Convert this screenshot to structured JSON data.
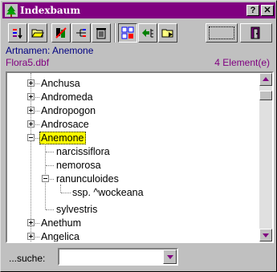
{
  "window": {
    "title": "Indexbaum",
    "help_label": "?",
    "close_label": "✕"
  },
  "toolbar": {
    "icons": [
      "sort-icon",
      "open-folder-icon",
      "tools-icon",
      "branch-icon",
      "trash-icon",
      "tree-grid-icon",
      "move-left-icon",
      "folder-open-icon",
      "select-button",
      "exit-door-icon"
    ]
  },
  "info": {
    "line1": "Artnamen: Anemone",
    "file": "Flora5.dbf",
    "count": "4 Element(e)"
  },
  "tree": {
    "nodes": [
      {
        "label": "Anchusa"
      },
      {
        "label": "Andromeda"
      },
      {
        "label": "Andropogon"
      },
      {
        "label": "Androsace"
      },
      {
        "label": "Anemone"
      },
      {
        "label": "narcissiflora"
      },
      {
        "label": "nemorosa"
      },
      {
        "label": "ranunculoides"
      },
      {
        "label": "ssp. ^wockeana"
      },
      {
        "label": "sylvestris"
      },
      {
        "label": "Anethum"
      },
      {
        "label": "Angelica"
      }
    ],
    "selected": "Anemone"
  },
  "search": {
    "label": "...suche:",
    "value": "",
    "placeholder": ""
  },
  "colors": {
    "titlebar": "#800080",
    "accent": "#800080",
    "info_text": "#000080",
    "selection": "#ffff00"
  }
}
